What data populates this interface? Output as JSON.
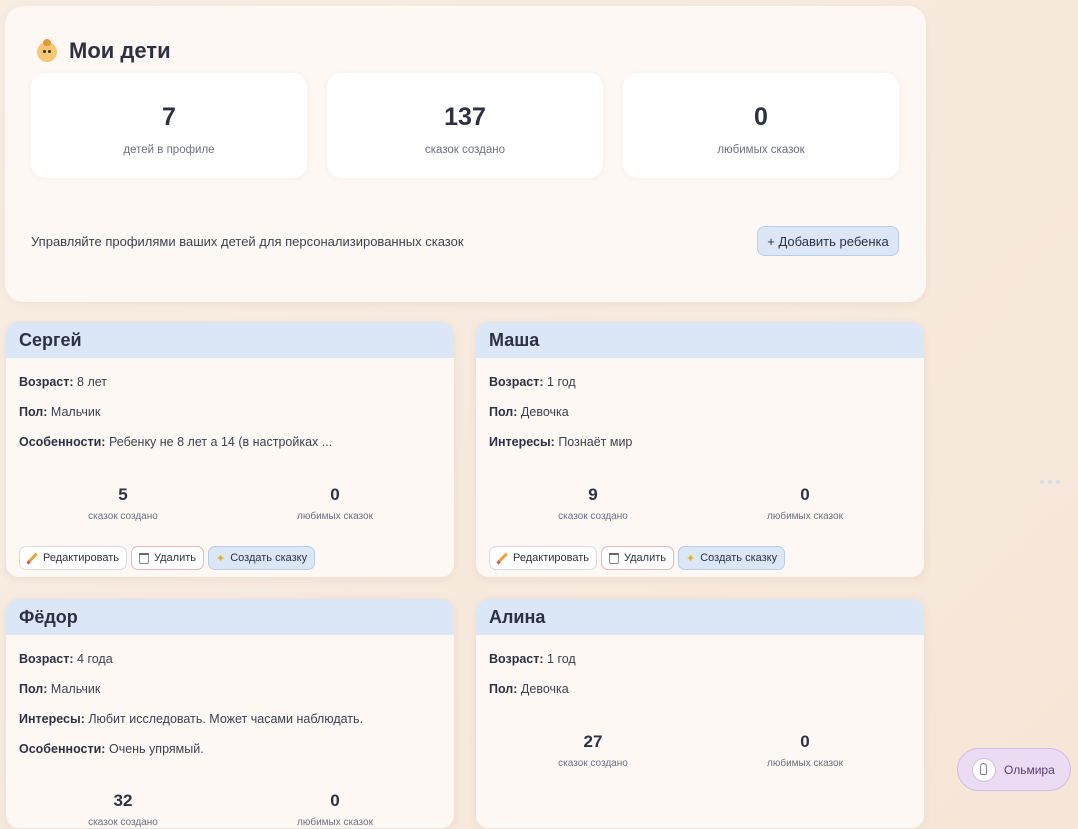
{
  "header": {
    "title": "Мои дети"
  },
  "stats": [
    {
      "value": "7",
      "label": "детей в профиле"
    },
    {
      "value": "137",
      "label": "сказок создано"
    },
    {
      "value": "0",
      "label": "любимых сказок"
    }
  ],
  "description": "Управляйте профилями ваших детей для персонализированных сказок",
  "add_button": "+ Добавить ребенка",
  "children": [
    {
      "name": "Сергей",
      "fields": [
        {
          "key": "Возраст:",
          "value": "8 лет"
        },
        {
          "key": "Пол:",
          "value": "Мальчик"
        },
        {
          "key": "Особенности:",
          "value": "Ребенку не 8 лет а 14 (в настройках ..."
        }
      ],
      "stories": "5",
      "stories_label": "сказок создано",
      "favorites": "0",
      "favorites_label": "любимых сказок"
    },
    {
      "name": "Маша",
      "fields": [
        {
          "key": "Возраст:",
          "value": "1 год"
        },
        {
          "key": "Пол:",
          "value": "Девочка"
        },
        {
          "key": "Интересы:",
          "value": "Познаёт мир"
        }
      ],
      "stories": "9",
      "stories_label": "сказок создано",
      "favorites": "0",
      "favorites_label": "любимых сказок"
    },
    {
      "name": "Фёдор",
      "fields": [
        {
          "key": "Возраст:",
          "value": "4 года"
        },
        {
          "key": "Пол:",
          "value": "Мальчик"
        },
        {
          "key": "Интересы:",
          "value": "Любит исследовать. Может часами наблюдать."
        },
        {
          "key": "Особенности:",
          "value": "Очень упрямый."
        }
      ],
      "stories": "32",
      "stories_label": "сказок создано",
      "favorites": "0",
      "favorites_label": "любимых сказок"
    },
    {
      "name": "Алина",
      "fields": [
        {
          "key": "Возраст:",
          "value": "1 год"
        },
        {
          "key": "Пол:",
          "value": "Девочка"
        }
      ],
      "stories": "27",
      "stories_label": "сказок создано",
      "favorites": "0",
      "favorites_label": "любимых сказок"
    }
  ],
  "actions": {
    "edit": "Редактировать",
    "delete": "Удалить",
    "create": "Создать сказку"
  },
  "assistant": {
    "name": "Ольмира"
  }
}
